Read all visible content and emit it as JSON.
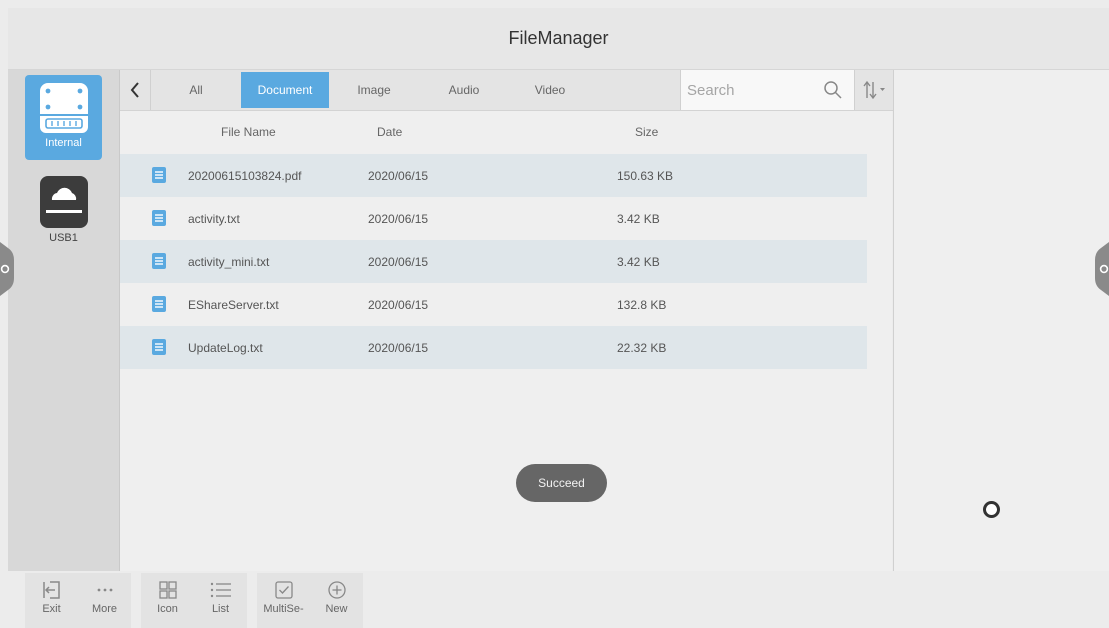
{
  "app": {
    "title": "FileManager"
  },
  "devices": [
    {
      "label": "Internal",
      "active": true,
      "icon": "hard-drive-icon"
    },
    {
      "label": "USB1",
      "active": false,
      "icon": "usb-cloud-drive-icon"
    }
  ],
  "tabs": [
    {
      "label": "All"
    },
    {
      "label": "Document"
    },
    {
      "label": "Image"
    },
    {
      "label": "Audio"
    },
    {
      "label": "Video"
    }
  ],
  "search": {
    "placeholder": "Search"
  },
  "columns": {
    "name": "File Name",
    "date": "Date",
    "size": "Size"
  },
  "files": [
    {
      "name": "20200615103824.pdf",
      "date": "2020/06/15",
      "size": "150.63 KB"
    },
    {
      "name": "activity.txt",
      "date": "2020/06/15",
      "size": "3.42 KB"
    },
    {
      "name": "activity_mini.txt",
      "date": "2020/06/15",
      "size": "3.42 KB"
    },
    {
      "name": "EShareServer.txt",
      "date": "2020/06/15",
      "size": "132.8 KB"
    },
    {
      "name": "UpdateLog.txt",
      "date": "2020/06/15",
      "size": "22.32 KB"
    }
  ],
  "toast": {
    "text": "Succeed"
  },
  "toolbar": {
    "exit": "Exit",
    "more": "More",
    "icon": "Icon",
    "list": "List",
    "multiselect": "MultiSe-",
    "new": "New"
  },
  "colors": {
    "accent": "#5aa9e0",
    "row_highlight": "#dfe6ea",
    "toast_bg": "#666666"
  }
}
